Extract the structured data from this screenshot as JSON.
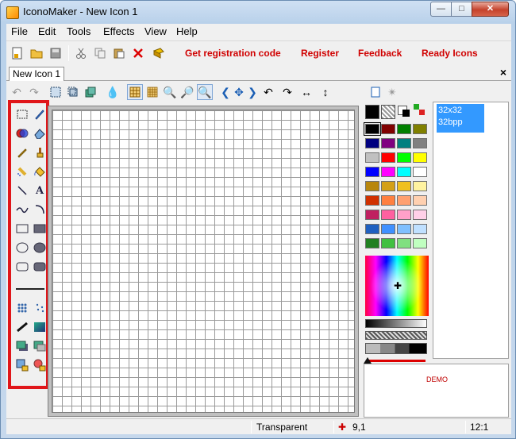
{
  "window": {
    "title": "IconoMaker - New Icon 1"
  },
  "menu": [
    "File",
    "Edit",
    "Tools",
    "Effects",
    "View",
    "Help"
  ],
  "toolbar_links": [
    "Get registration code",
    "Register",
    "Feedback",
    "Ready Icons"
  ],
  "document_tab": "New Icon 1",
  "sizes": {
    "item1": "32x32",
    "item2": "32bpp"
  },
  "demo_label": "DEMO",
  "status": {
    "color_mode": "Transparent",
    "coords": "9,1",
    "zoom": "12:1"
  },
  "palette": {
    "swatches": [
      [
        "#000000",
        "#800000",
        "#008000",
        "#808000"
      ],
      [
        "#000080",
        "#800080",
        "#008080",
        "#808080"
      ],
      [
        "#c0c0c0",
        "#ff0000",
        "#00ff00",
        "#ffff00"
      ],
      [
        "#0000ff",
        "#ff00ff",
        "#00ffff",
        "#ffffff"
      ],
      [
        "#b8860b",
        "#d4a017",
        "#f0c020",
        "#fff3a0"
      ],
      [
        "#d03000",
        "#ff8040",
        "#ffa070",
        "#ffd0b0"
      ],
      [
        "#c02060",
        "#ff60a0",
        "#ffa0c8",
        "#ffd0e8"
      ],
      [
        "#2060c0",
        "#4090ff",
        "#80c0ff",
        "#c0e0ff"
      ],
      [
        "#208020",
        "#40c040",
        "#80e080",
        "#c0ffc0"
      ]
    ]
  }
}
